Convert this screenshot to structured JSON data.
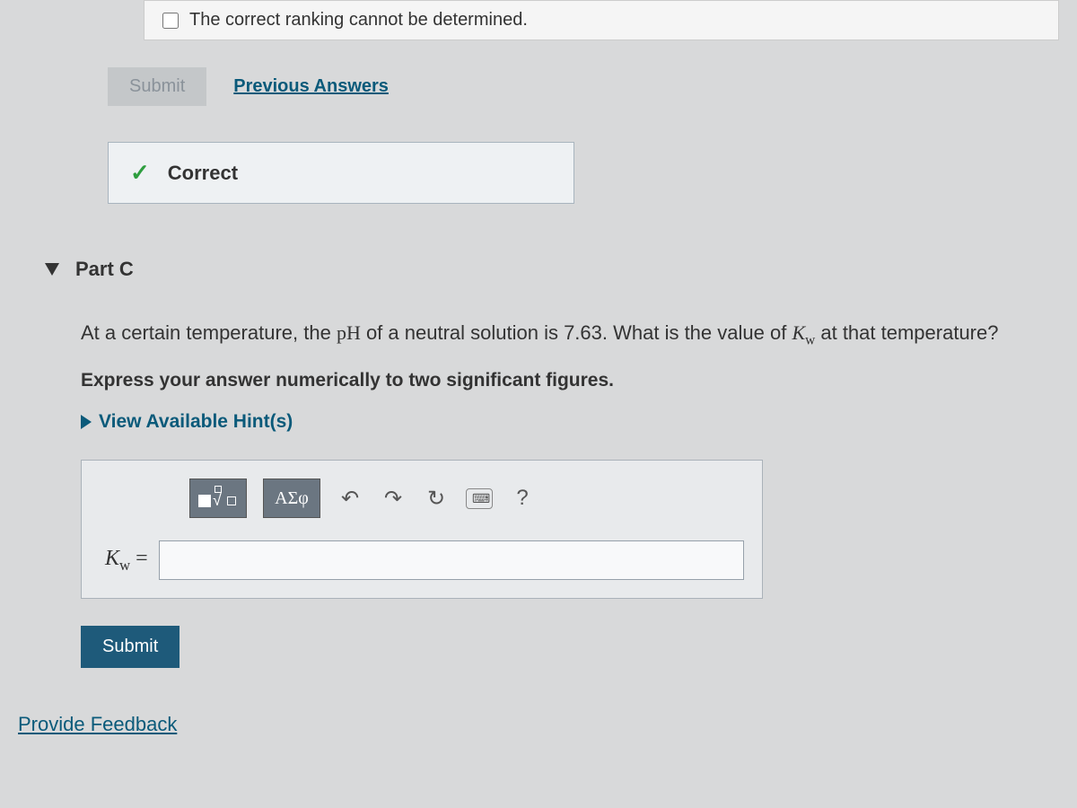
{
  "top_option": {
    "label": "The correct ranking cannot be determined."
  },
  "buttons": {
    "submit_disabled": "Submit",
    "previous_answers": "Previous Answers",
    "submit_active": "Submit"
  },
  "feedback": {
    "correct_label": "Correct"
  },
  "part": {
    "title": "Part C",
    "question_prefix": "At a certain temperature, the ",
    "question_ph": "pH",
    "question_mid": " of a neutral solution is 7.63. What is the value of ",
    "question_kw": "K",
    "question_kw_sub": "w",
    "question_suffix": " at that temperature?",
    "instruction": "Express your answer numerically to two significant figures.",
    "hints_label": "View Available Hint(s)"
  },
  "toolbar": {
    "greek_label": "ΑΣφ",
    "help_label": "?"
  },
  "answer": {
    "var": "K",
    "var_sub": "w",
    "equals": " ="
  },
  "footer": {
    "provide_feedback": "Provide Feedback"
  }
}
